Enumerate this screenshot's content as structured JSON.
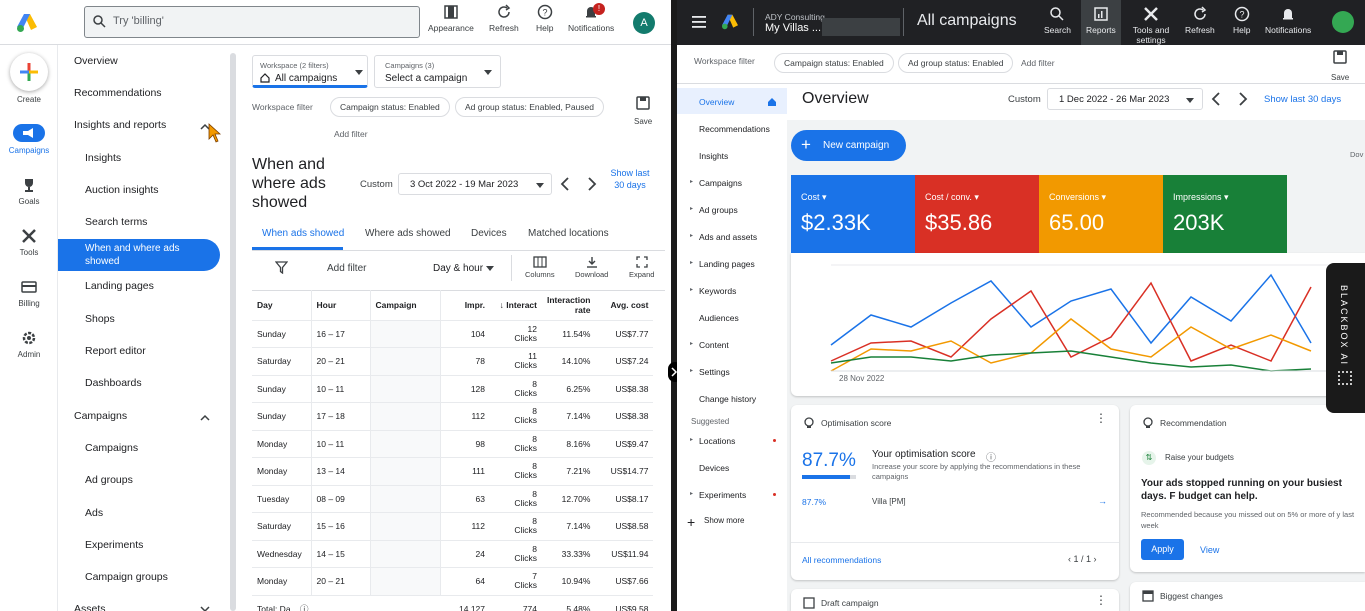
{
  "left": {
    "search_placeholder": "Try 'billing'",
    "toolbar": {
      "appearance": "Appearance",
      "refresh": "Refresh",
      "help": "Help",
      "notifications": "Notifications",
      "notif_count": "!",
      "avatar": "A"
    },
    "rail": {
      "create": "Create",
      "campaigns": "Campaigns",
      "goals": "Goals",
      "tools": "Tools",
      "billing": "Billing",
      "admin": "Admin"
    },
    "nav": {
      "overview": "Overview",
      "recommendations": "Recommendations",
      "insights_reports": "Insights and reports",
      "insights": "Insights",
      "auction_insights": "Auction insights",
      "search_terms": "Search terms",
      "when_where": "When and where ads showed",
      "landing_pages": "Landing pages",
      "shops": "Shops",
      "report_editor": "Report editor",
      "dashboards": "Dashboards",
      "campaigns_header": "Campaigns",
      "campaigns": "Campaigns",
      "ad_groups": "Ad groups",
      "ads": "Ads",
      "experiments": "Experiments",
      "campaign_groups": "Campaign groups",
      "assets": "Assets"
    },
    "workspace": {
      "label": "Workspace (2 filters)",
      "value": "All campaigns"
    },
    "campaigns_select": {
      "label": "Campaigns (3)",
      "value": "Select a campaign"
    },
    "filter_label": "Workspace filter",
    "chips": [
      "Campaign status: Enabled",
      "Ad group status: Enabled, Paused"
    ],
    "add_filter": "Add filter",
    "save": "Save",
    "page_title": "When and where ads showed",
    "date": {
      "label": "Custom",
      "range": "3 Oct 2022 - 19 Mar 2023",
      "show_last": "Show last 30 days"
    },
    "tabs": [
      "When ads showed",
      "Where ads showed",
      "Devices",
      "Matched locations"
    ],
    "table_toolbar": {
      "add_filter": "Add filter",
      "segment": "Day & hour",
      "columns": "Columns",
      "download": "Download",
      "expand": "Expand"
    },
    "columns": [
      "Day",
      "Hour",
      "Campaign",
      "Impr.",
      "Interact",
      "Interaction rate",
      "Avg. cost"
    ],
    "rows": [
      {
        "day": "Sunday",
        "hour": "16 – 17",
        "impr": "104",
        "int": "12",
        "rate": "11.54%",
        "cost": "US$7.77"
      },
      {
        "day": "Saturday",
        "hour": "20 – 21",
        "impr": "78",
        "int": "11",
        "rate": "14.10%",
        "cost": "US$7.24"
      },
      {
        "day": "Sunday",
        "hour": "10 – 11",
        "impr": "128",
        "int": "8",
        "rate": "6.25%",
        "cost": "US$8.38"
      },
      {
        "day": "Sunday",
        "hour": "17 – 18",
        "impr": "112",
        "int": "8",
        "rate": "7.14%",
        "cost": "US$8.38"
      },
      {
        "day": "Monday",
        "hour": "10 – 11",
        "impr": "98",
        "int": "8",
        "rate": "8.16%",
        "cost": "US$9.47"
      },
      {
        "day": "Monday",
        "hour": "13 – 14",
        "impr": "111",
        "int": "8",
        "rate": "7.21%",
        "cost": "US$14.77"
      },
      {
        "day": "Tuesday",
        "hour": "08 – 09",
        "impr": "63",
        "int": "8",
        "rate": "12.70%",
        "cost": "US$8.17"
      },
      {
        "day": "Saturday",
        "hour": "15 – 16",
        "impr": "112",
        "int": "8",
        "rate": "7.14%",
        "cost": "US$8.58"
      },
      {
        "day": "Wednesday",
        "hour": "14 – 15",
        "impr": "24",
        "int": "8",
        "rate": "33.33%",
        "cost": "US$11.94"
      },
      {
        "day": "Monday",
        "hour": "20 – 21",
        "impr": "64",
        "int": "7",
        "rate": "10.94%",
        "cost": "US$7.66"
      }
    ],
    "clicks_unit": "Clicks",
    "total": {
      "label": "Total: Da...",
      "impr": "14,127",
      "int": "774",
      "rate": "5.48%",
      "cost": "US$9.58"
    }
  },
  "right": {
    "account": {
      "parent": "ADY Consulting",
      "name": "My Villas ..."
    },
    "title": "All campaigns",
    "toolbar": {
      "search": "Search",
      "reports": "Reports",
      "tools": "Tools and settings",
      "refresh": "Refresh",
      "help": "Help",
      "notifications": "Notifications"
    },
    "filter_label": "Workspace filter",
    "chips": [
      "Campaign status: Enabled",
      "Ad group status: Enabled"
    ],
    "add_filter": "Add filter",
    "save": "Save",
    "nav": [
      "Overview",
      "Recommendations",
      "Insights",
      "Campaigns",
      "Ad groups",
      "Ads and assets",
      "Landing pages",
      "Keywords",
      "Audiences",
      "Content",
      "Settings",
      "Change history"
    ],
    "suggested": "Suggested",
    "suggested_items": [
      "Locations",
      "Devices",
      "Experiments"
    ],
    "show_more": "Show more",
    "page_title": "Overview",
    "date": {
      "label": "Custom",
      "range": "1 Dec 2022 - 26 Mar 2023",
      "show_last": "Show last 30 days"
    },
    "new_campaign": "New campaign",
    "metrics": [
      {
        "label": "Cost",
        "value": "$2.33K",
        "color": "#1a73e8"
      },
      {
        "label": "Cost / conv.",
        "value": "$35.86",
        "color": "#d93025"
      },
      {
        "label": "Conversions",
        "value": "65.00",
        "color": "#f29900"
      },
      {
        "label": "Impressions",
        "value": "203K",
        "color": "#188038"
      }
    ],
    "chart_start": "28 Nov 2022",
    "chart_edge": "Dov",
    "opt": {
      "title": "Optimisation score",
      "score": "87.7%",
      "heading": "Your optimisation score",
      "desc": "Increase your score by applying the recommendations in these campaigns",
      "row_score": "87.7%",
      "row_name": "Villa [PM]",
      "all": "All recommendations",
      "pager": "1 / 1"
    },
    "rec": {
      "title": "Recommendation",
      "sub": "Raise your budgets",
      "heading": "Your ads stopped running on your busiest days. F budget can help.",
      "note": "Recommended because you missed out on 5% or more of y last week",
      "apply": "Apply",
      "view": "View"
    },
    "draft": "Draft campaign",
    "biggest": "Biggest changes",
    "blackbox": "BLACKBOX AI"
  }
}
